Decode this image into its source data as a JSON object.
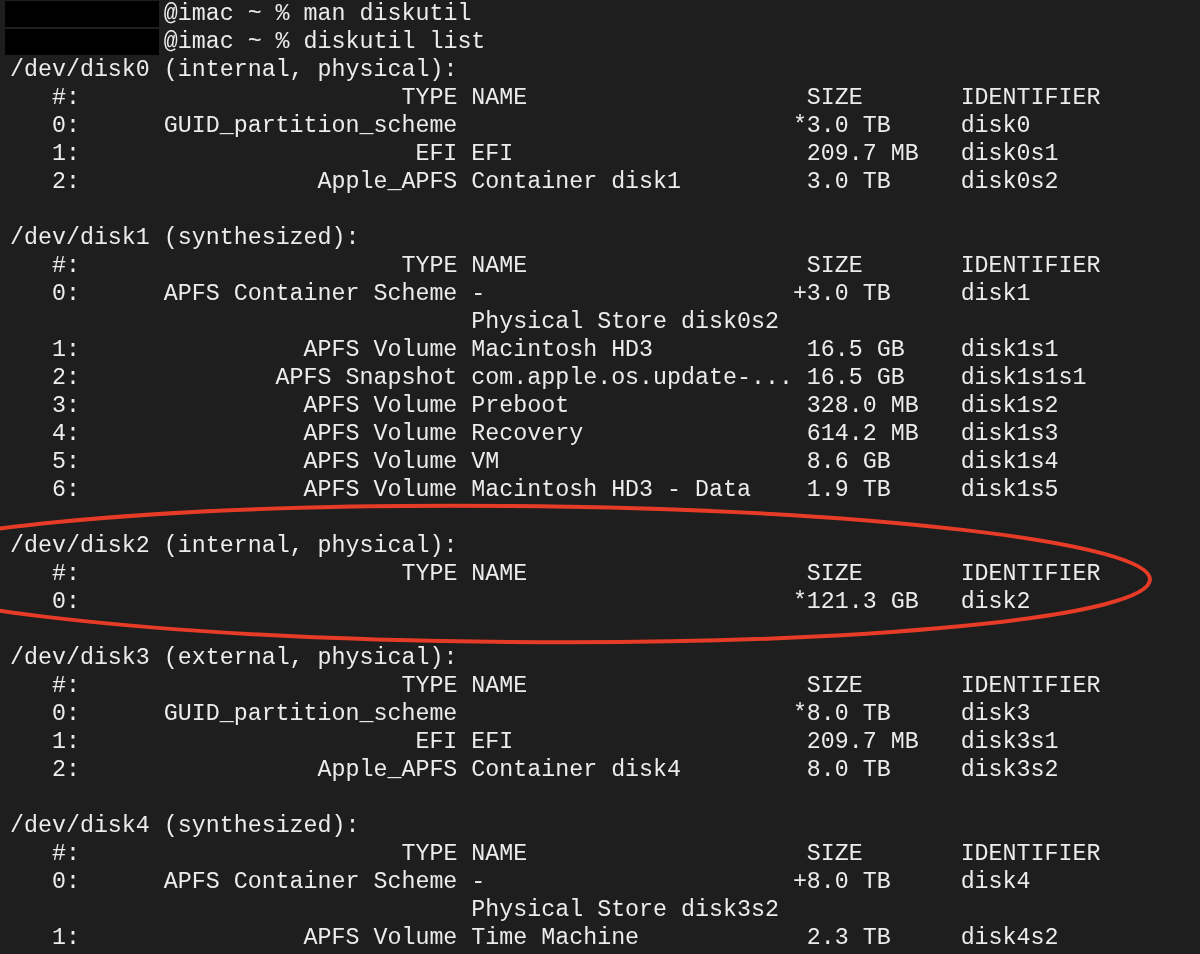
{
  "prompts": [
    {
      "host": "@imac ~ % ",
      "command": "man diskutil"
    },
    {
      "host": "@imac ~ % ",
      "command": "diskutil list"
    }
  ],
  "disks": [
    {
      "header": "/dev/disk0 (internal, physical):",
      "highlighted": false,
      "columns": {
        "number": "#:",
        "type": "TYPE",
        "name": "NAME",
        "size": "SIZE",
        "identifier": "IDENTIFIER"
      },
      "partitions": [
        {
          "number": "0:",
          "type": "GUID_partition_scheme",
          "size_mark": "*",
          "size": "3.0 TB",
          "identifier": "disk0"
        },
        {
          "number": "1:",
          "type": "EFI",
          "name": "EFI",
          "size": "209.7 MB",
          "identifier": "disk0s1"
        },
        {
          "number": "2:",
          "type": "Apple_APFS",
          "name": "Container disk1",
          "size": "3.0 TB",
          "identifier": "disk0s2"
        }
      ]
    },
    {
      "header": "/dev/disk1 (synthesized):",
      "highlighted": false,
      "columns": {
        "number": "#:",
        "type": "TYPE",
        "name": "NAME",
        "size": "SIZE",
        "identifier": "IDENTIFIER"
      },
      "partitions": [
        {
          "number": "0:",
          "type": "APFS Container Scheme",
          "name": "-",
          "size_mark": "+",
          "size": "3.0 TB",
          "identifier": "disk1",
          "name_line2": "Physical Store disk0s2"
        },
        {
          "number": "1:",
          "type": "APFS Volume",
          "name": "Macintosh HD3",
          "size": "16.5 GB",
          "identifier": "disk1s1"
        },
        {
          "number": "2:",
          "type": "APFS Snapshot",
          "name": "com.apple.os.update-...",
          "size": "16.5 GB",
          "identifier": "disk1s1s1"
        },
        {
          "number": "3:",
          "type": "APFS Volume",
          "name": "Preboot",
          "size": "328.0 MB",
          "identifier": "disk1s2"
        },
        {
          "number": "4:",
          "type": "APFS Volume",
          "name": "Recovery",
          "size": "614.2 MB",
          "identifier": "disk1s3"
        },
        {
          "number": "5:",
          "type": "APFS Volume",
          "name": "VM",
          "size": "8.6 GB",
          "identifier": "disk1s4"
        },
        {
          "number": "6:",
          "type": "APFS Volume",
          "name": "Macintosh HD3 - Data",
          "size": "1.9 TB",
          "identifier": "disk1s5"
        }
      ]
    },
    {
      "header": "/dev/disk2 (internal, physical):",
      "highlighted": true,
      "columns": {
        "number": "#:",
        "type": "TYPE",
        "name": "NAME",
        "size": "SIZE",
        "identifier": "IDENTIFIER"
      },
      "partitions": [
        {
          "number": "0:",
          "size_mark": "*",
          "size": "121.3 GB",
          "identifier": "disk2"
        }
      ]
    },
    {
      "header": "/dev/disk3 (external, physical):",
      "highlighted": false,
      "columns": {
        "number": "#:",
        "type": "TYPE",
        "name": "NAME",
        "size": "SIZE",
        "identifier": "IDENTIFIER"
      },
      "partitions": [
        {
          "number": "0:",
          "type": "GUID_partition_scheme",
          "size_mark": "*",
          "size": "8.0 TB",
          "identifier": "disk3"
        },
        {
          "number": "1:",
          "type": "EFI",
          "name": "EFI",
          "size": "209.7 MB",
          "identifier": "disk3s1"
        },
        {
          "number": "2:",
          "type": "Apple_APFS",
          "name": "Container disk4",
          "size": "8.0 TB",
          "identifier": "disk3s2"
        }
      ]
    },
    {
      "header": "/dev/disk4 (synthesized):",
      "highlighted": false,
      "columns": {
        "number": "#:",
        "type": "TYPE",
        "name": "NAME",
        "size": "SIZE",
        "identifier": "IDENTIFIER"
      },
      "partitions": [
        {
          "number": "0:",
          "type": "APFS Container Scheme",
          "name": "-",
          "size_mark": "+",
          "size": "8.0 TB",
          "identifier": "disk4",
          "name_line2": "Physical Store disk3s2"
        },
        {
          "number": "1:",
          "type": "APFS Volume",
          "name": "Time Machine",
          "size": "2.3 TB",
          "identifier": "disk4s2"
        }
      ]
    }
  ]
}
